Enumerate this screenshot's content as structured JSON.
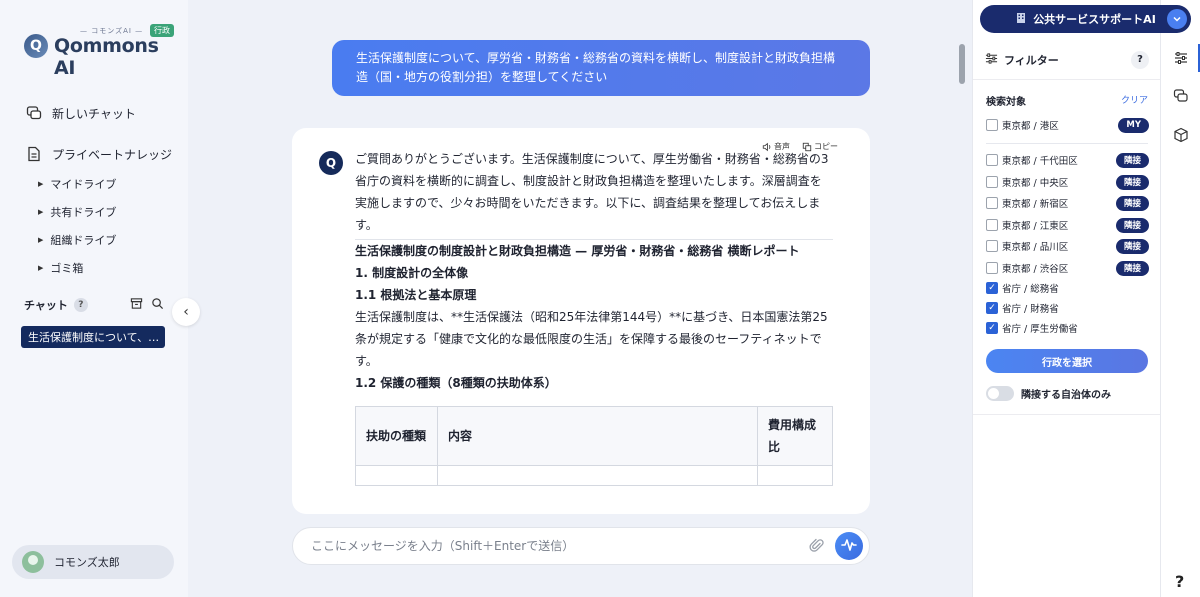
{
  "brand": {
    "name": "Qommons AI",
    "kana": "— コモンズAI —",
    "badge": "行政",
    "mark": "Q"
  },
  "sidebar": {
    "new_chat": "新しいチャット",
    "private_knowledge": "プライベートナレッジ",
    "drives": [
      "マイドライブ",
      "共有ドライブ",
      "組織ドライブ",
      "ゴミ箱"
    ],
    "chat_section": "チャット",
    "chat_help": "?",
    "active_chat": "生活保護制度について、…",
    "user_name": "コモンズ太郎"
  },
  "main": {
    "user_message": "生活保護制度について、厚労省・財務省・総務省の資料を横断し、制度設計と財政負担構造（国・地方の役割分担）を整理してください",
    "actions": {
      "speech": "音声",
      "copy": "コピー"
    },
    "ai_mark": "Q",
    "answer": {
      "intro": "ご質問ありがとうございます。生活保護制度について、厚生労働省・財務省・総務省の3省庁の資料を横断的に調査し、制度設計と財政負担構造を整理いたします。深層調査を実施しますので、少々お時間をいただきます。以下に、調査結果を整理してお伝えします。",
      "report_title": "生活保護制度の制度設計と財政負担構造 — 厚労省・財務省・総務省 横断レポート",
      "section1": "1. 制度設計の全体像",
      "section1_1": "1.1 根拠法と基本原理",
      "section1_1_body": "生活保護制度は、**生活保護法（昭和25年法律第144号）**に基づき、日本国憲法第25条が規定する「健康で文化的な最低限度の生活」を保障する最後のセーフティネットです。",
      "section1_2": "1.2 保護の種類（8種類の扶助体系）",
      "table_headers": [
        "扶助の種類",
        "内容",
        "費用構成比"
      ]
    },
    "composer": {
      "placeholder": "ここにメッセージを入力（Shift＋Enterで送信）"
    }
  },
  "right_panel": {
    "service": "公共サービスサポートAI",
    "filter_title": "フィルター",
    "filter_help": "?",
    "search_target": "検索対象",
    "clear": "クリア",
    "my_item": {
      "label": "東京都 / 港区",
      "tag": "MY",
      "checked": false
    },
    "neighbors": [
      {
        "label": "東京都 / 千代田区",
        "tag": "隣接",
        "checked": false
      },
      {
        "label": "東京都 / 中央区",
        "tag": "隣接",
        "checked": false
      },
      {
        "label": "東京都 / 新宿区",
        "tag": "隣接",
        "checked": false
      },
      {
        "label": "東京都 / 江東区",
        "tag": "隣接",
        "checked": false
      },
      {
        "label": "東京都 / 品川区",
        "tag": "隣接",
        "checked": false
      },
      {
        "label": "東京都 / 渋谷区",
        "tag": "隣接",
        "checked": false
      }
    ],
    "ministries": [
      {
        "label": "省庁 / 総務省",
        "checked": true
      },
      {
        "label": "省庁 / 財務省",
        "checked": true
      },
      {
        "label": "省庁 / 厚生労働省",
        "checked": true
      }
    ],
    "select_button": "行政を選択",
    "toggle_label": "隣接する自治体のみ"
  },
  "rail": {
    "help": "?"
  },
  "colors": {
    "accent": "#2b62d6",
    "navy": "#1a2b6d",
    "bubble": "#4a7cf0"
  }
}
